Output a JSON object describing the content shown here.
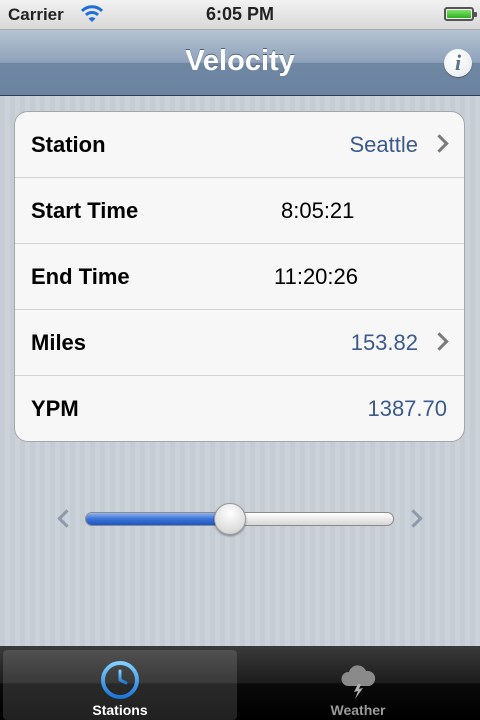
{
  "status_bar": {
    "carrier": "Carrier",
    "time": "6:05 PM",
    "icons": [
      "wifi-icon",
      "battery-icon"
    ]
  },
  "navbar": {
    "title": "Velocity",
    "info_button": "info-icon"
  },
  "table": {
    "rows": [
      {
        "label": "Station",
        "value": "Seattle",
        "disclosure": true,
        "value_color": "#3c5a8c"
      },
      {
        "label": "Start Time",
        "value": "8:05:21",
        "disclosure": false,
        "value_color": "#000000"
      },
      {
        "label": "End Time",
        "value": "11:20:26",
        "disclosure": false,
        "value_color": "#000000"
      },
      {
        "label": "Miles",
        "value": "153.82",
        "disclosure": true,
        "value_color": "#3c5a8c"
      },
      {
        "label": "YPM",
        "value": "1387.70",
        "disclosure": false,
        "value_color": "#3c5a8c"
      }
    ]
  },
  "slider": {
    "value": 0.47,
    "left_icon": "chevron-left-icon",
    "right_icon": "chevron-right-icon"
  },
  "tab_bar": {
    "tabs": [
      {
        "label": "Stations",
        "icon": "clock-icon",
        "selected": true
      },
      {
        "label": "Weather",
        "icon": "storm-cloud-icon",
        "selected": false
      }
    ]
  },
  "colors": {
    "accent_blue": "#3c5a8c",
    "navbar": "#7a90ab",
    "tab_icon_selected": "#1e90e6"
  }
}
